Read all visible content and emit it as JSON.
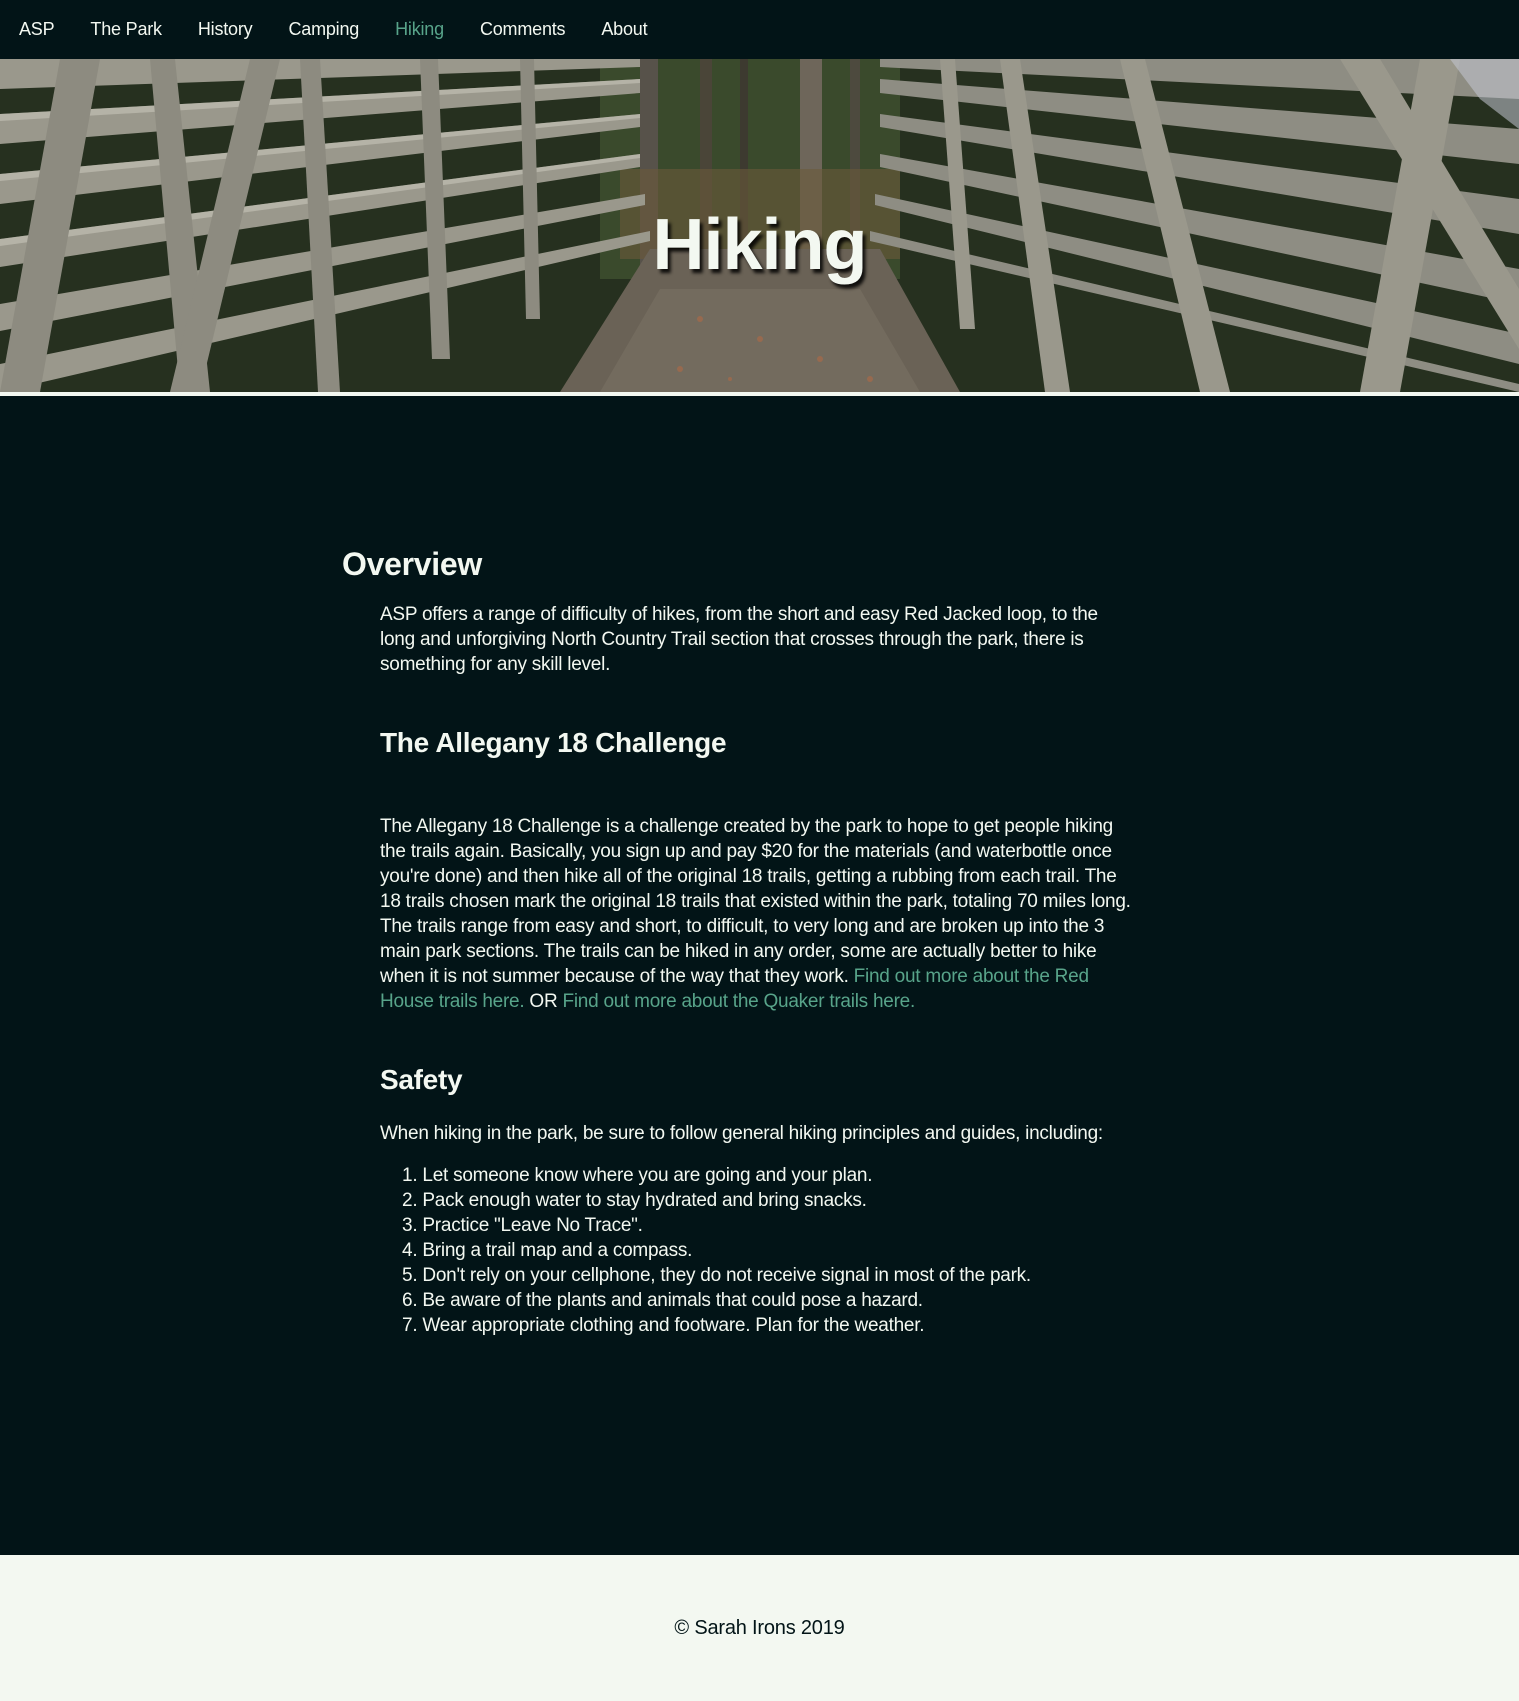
{
  "nav": {
    "items": [
      {
        "label": "ASP",
        "active": false
      },
      {
        "label": "The Park",
        "active": false
      },
      {
        "label": "History",
        "active": false
      },
      {
        "label": "Camping",
        "active": false
      },
      {
        "label": "Hiking",
        "active": true
      },
      {
        "label": "Comments",
        "active": false
      },
      {
        "label": "About",
        "active": false
      }
    ],
    "active_color": "#58a48a"
  },
  "hero": {
    "title": "Hiking",
    "image": "forest-footbridge-photo"
  },
  "overview": {
    "heading": "Overview",
    "text": "ASP offers a range of difficulty of hikes, from the short and easy Red Jacked loop, to the long and unforgiving North Country Trail section that crosses through the park, there is something for any skill level."
  },
  "challenge": {
    "heading": "The Allegany 18 Challenge",
    "text": "The Allegany 18 Challenge is a challenge created by the park to hope to get people hiking the trails again. Basically, you sign up and pay $20 for the materials (and waterbottle once you're done) and then hike all of the original 18 trails, getting a rubbing from each trail. The 18 trails chosen mark the original 18 trails that existed within the park, totaling 70 miles long. The trails range from easy and short, to difficult, to very long and are broken up into the 3 main park sections. The trails can be hiked in any order, some are actually better to hike when it is not summer because of the way that they work. ",
    "link_red_house": "Find out more about the Red House trails here.",
    "or_text": " OR ",
    "link_quaker": "Find out more about the Quaker trails here."
  },
  "safety": {
    "heading": "Safety",
    "intro": "When hiking in the park, be sure to follow general hiking principles and guides, including:",
    "rules": [
      "Let someone know where you are going and your plan.",
      "Pack enough water to stay hydrated and bring snacks.",
      "Practice \"Leave No Trace\".",
      "Bring a trail map and a compass.",
      "Don't rely on your cellphone, they do not receive signal in most of the park.",
      "Be aware of the plants and animals that could pose a hazard.",
      "Wear appropriate clothing and footware. Plan for the weather."
    ]
  },
  "footer": {
    "text": "© Sarah Irons 2019"
  },
  "colors": {
    "background": "#021417",
    "text": "#f3f8f1",
    "link": "#58a48a",
    "footer_bg": "#f3f8f1"
  }
}
